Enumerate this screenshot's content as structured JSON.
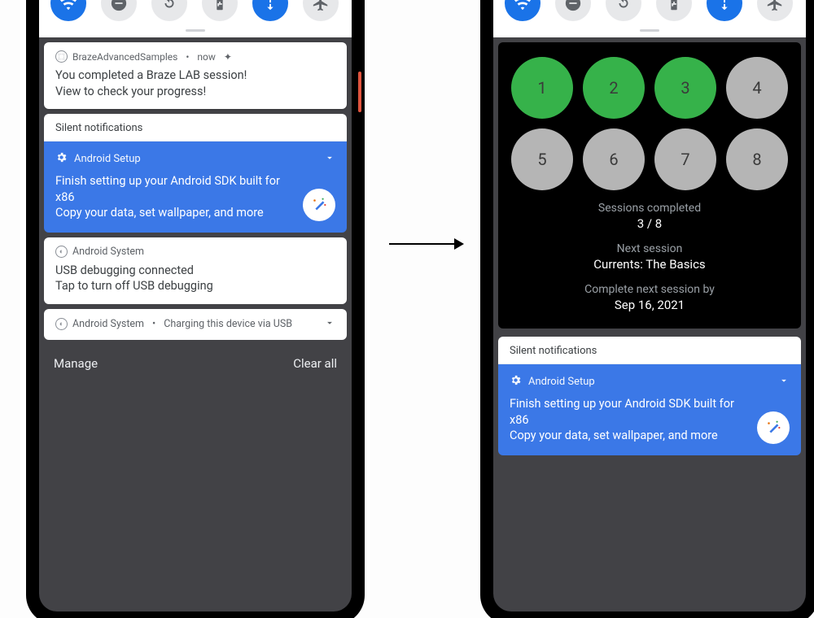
{
  "qs_tiles": [
    {
      "name": "wifi",
      "on": true
    },
    {
      "name": "dnd",
      "on": false
    },
    {
      "name": "rotate",
      "on": false
    },
    {
      "name": "battery-saver",
      "on": false
    },
    {
      "name": "mobile-data",
      "on": true
    },
    {
      "name": "airplane",
      "on": false
    }
  ],
  "left": {
    "notif1": {
      "app": "BrazeAdvancedSamples",
      "time": "now",
      "line1": "You completed a Braze LAB session!",
      "line2": "View to check your progress!"
    },
    "silent_label": "Silent notifications",
    "setup": {
      "app": "Android Setup",
      "line1": "Finish setting up your Android SDK built for x86",
      "line2": "Copy your data, set wallpaper, and more"
    },
    "usb": {
      "app": "Android System",
      "line1": "USB debugging connected",
      "line2": "Tap to turn off USB debugging"
    },
    "charging": {
      "app": "Android System",
      "text": "Charging this device via USB"
    },
    "footer": {
      "manage": "Manage",
      "clear": "Clear all"
    }
  },
  "right": {
    "sessions": [
      {
        "n": "1",
        "done": true
      },
      {
        "n": "2",
        "done": true
      },
      {
        "n": "3",
        "done": true
      },
      {
        "n": "4",
        "done": false
      },
      {
        "n": "5",
        "done": false
      },
      {
        "n": "6",
        "done": false
      },
      {
        "n": "7",
        "done": false
      },
      {
        "n": "8",
        "done": false
      }
    ],
    "completed_label": "Sessions completed",
    "completed_value": "3 / 8",
    "next_label": "Next session",
    "next_value": "Currents: The Basics",
    "due_label": "Complete next session by",
    "due_value": "Sep 16, 2021",
    "silent_label": "Silent notifications",
    "setup": {
      "app": "Android Setup",
      "line1": "Finish setting up your Android SDK built for x86",
      "line2": "Copy your data, set wallpaper, and more"
    }
  }
}
